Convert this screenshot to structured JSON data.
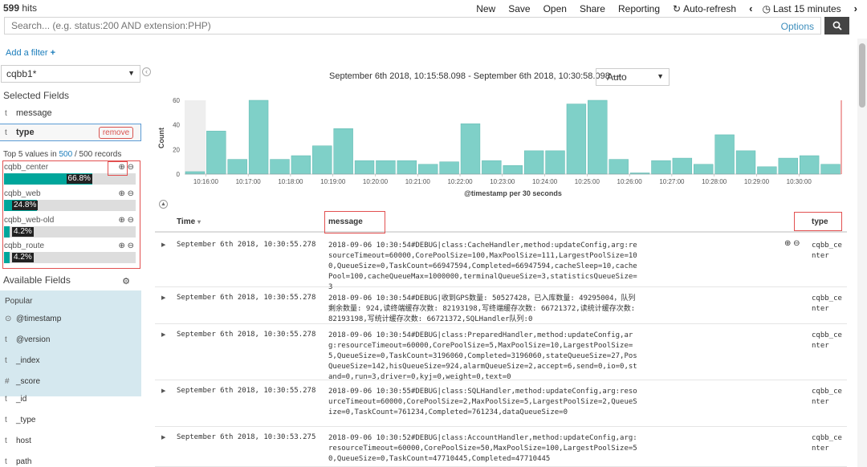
{
  "topbar": {
    "hits_count": "599",
    "hits_label": "hits",
    "nav": [
      "New",
      "Save",
      "Open",
      "Share",
      "Reporting"
    ],
    "auto_refresh": "Auto-refresh",
    "time_label": "Last 15 minutes"
  },
  "search": {
    "placeholder": "Search... (e.g. status:200 AND extension:PHP)",
    "options": "Options"
  },
  "add_filter": "Add a filter",
  "sidebar": {
    "index": "cqbb1*",
    "selected_title": "Selected Fields",
    "selected": [
      {
        "type": "t",
        "name": "message"
      },
      {
        "type": "t",
        "name": "type"
      }
    ],
    "remove": "remove",
    "top5_prefix": "Top 5 values in",
    "top5_count": "500",
    "top5_sep": "/",
    "top5_total": "500 records",
    "values": [
      {
        "name": "cqbb_center",
        "pct": "66.8%",
        "fraction": 0.668
      },
      {
        "name": "cqbb_web",
        "pct": "24.8%",
        "fraction": 0.248
      },
      {
        "name": "cqbb_web-old",
        "pct": "4.2%",
        "fraction": 0.042
      },
      {
        "name": "cqbb_route",
        "pct": "4.2%",
        "fraction": 0.042
      }
    ],
    "available_title": "Available Fields",
    "popular_title": "Popular",
    "popular": [
      {
        "type": "⊙",
        "name": "@timestamp"
      },
      {
        "type": "t",
        "name": "@version"
      },
      {
        "type": "t",
        "name": "_index"
      },
      {
        "type": "#",
        "name": "_score"
      }
    ],
    "others": [
      {
        "type": "t",
        "name": "_id"
      },
      {
        "type": "t",
        "name": "_type"
      },
      {
        "type": "t",
        "name": "host"
      },
      {
        "type": "t",
        "name": "path"
      }
    ]
  },
  "time_range": "September 6th 2018, 10:15:58.098 - September 6th 2018, 10:30:58.098 —",
  "interval": "Auto",
  "chart_data": {
    "type": "bar",
    "xlabel": "@timestamp per 30 seconds",
    "ylabel": "Count",
    "ylim": [
      0,
      60
    ],
    "yticks": [
      0,
      20,
      40,
      60
    ],
    "xticks": [
      "10:16:00",
      "10:17:00",
      "10:18:00",
      "10:19:00",
      "10:20:00",
      "10:21:00",
      "10:22:00",
      "10:23:00",
      "10:24:00",
      "10:25:00",
      "10:26:00",
      "10:27:00",
      "10:28:00",
      "10:29:00",
      "10:30:00"
    ],
    "values": [
      2,
      35,
      12,
      60,
      12,
      15,
      23,
      37,
      11,
      11,
      11,
      8,
      10,
      41,
      11,
      7,
      19,
      19,
      57,
      60,
      12,
      1,
      11,
      13,
      8,
      32,
      19,
      6,
      13,
      15,
      8
    ],
    "color": "#7fd0c8"
  },
  "table": {
    "headers": {
      "time": "Time",
      "message": "message",
      "type": "type"
    },
    "rows": [
      {
        "time": "September 6th 2018, 10:30:55.278",
        "message": "2018-09-06 10:30:54#DEBUG|class:CacheHandler,method:updateConfig,arg:resourceTimeout=60000,CorePoolSize=100,MaxPoolSize=111,LargestPoolSize=100,QueueSize=0,TaskCount=66947594,Completed=66947594,cacheSleep=10,cachePool=100,cacheQueueMax=1000000,terminalQueueSize=3,statisticsQueueSize=3",
        "type": "cqbb_center"
      },
      {
        "time": "September 6th 2018, 10:30:55.278",
        "message": "2018-09-06 10:30:54#DEBUG|收到GPS数量: 50527428，已入库数量: 49295004，队列剩余数量: 924,读终端缓存次数: 82193198,写终端缓存次数: 66721372,读统计缓存次数: 82193198,写统计缓存次数: 66721372,SQLHandler队列:0",
        "type": "cqbb_center"
      },
      {
        "time": "September 6th 2018, 10:30:55.278",
        "message": "2018-09-06 10:30:54#DEBUG|class:PreparedHandler,method:updateConfig,arg:resourceTimeout=60000,CorePoolSize=5,MaxPoolSize=10,LargestPoolSize=5,QueueSize=0,TaskCount=3196060,Completed=3196060,stateQueueSize=27,PosQueueSize=142,hisQueueSize=924,alarmQueueSize=2,accept=6,send=0,io=0,stand=0,run=3,driver=0,kyj=0,weight=0,text=0",
        "type": "cqbb_center"
      },
      {
        "time": "September 6th 2018, 10:30:55.278",
        "message": "2018-09-06 10:30:55#DEBUG|class:SQLHandler,method:updateConfig,arg:resourceTimeout=60000,CorePoolSize=2,MaxPoolSize=5,LargestPoolSize=2,QueueSize=0,TaskCount=761234,Completed=761234,dataQueueSize=0",
        "type": "cqbb_center"
      },
      {
        "time": "September 6th 2018, 10:30:53.275",
        "message": "2018-09-06 10:30:52#DEBUG|class:AccountHandler,method:updateConfig,arg:resourceTimeout=60000,CorePoolSize=50,MaxPoolSize=100,LargestPoolSize=50,QueueSize=0,TaskCount=47710445,Completed=47710445",
        "type": "cqbb_center"
      }
    ]
  }
}
